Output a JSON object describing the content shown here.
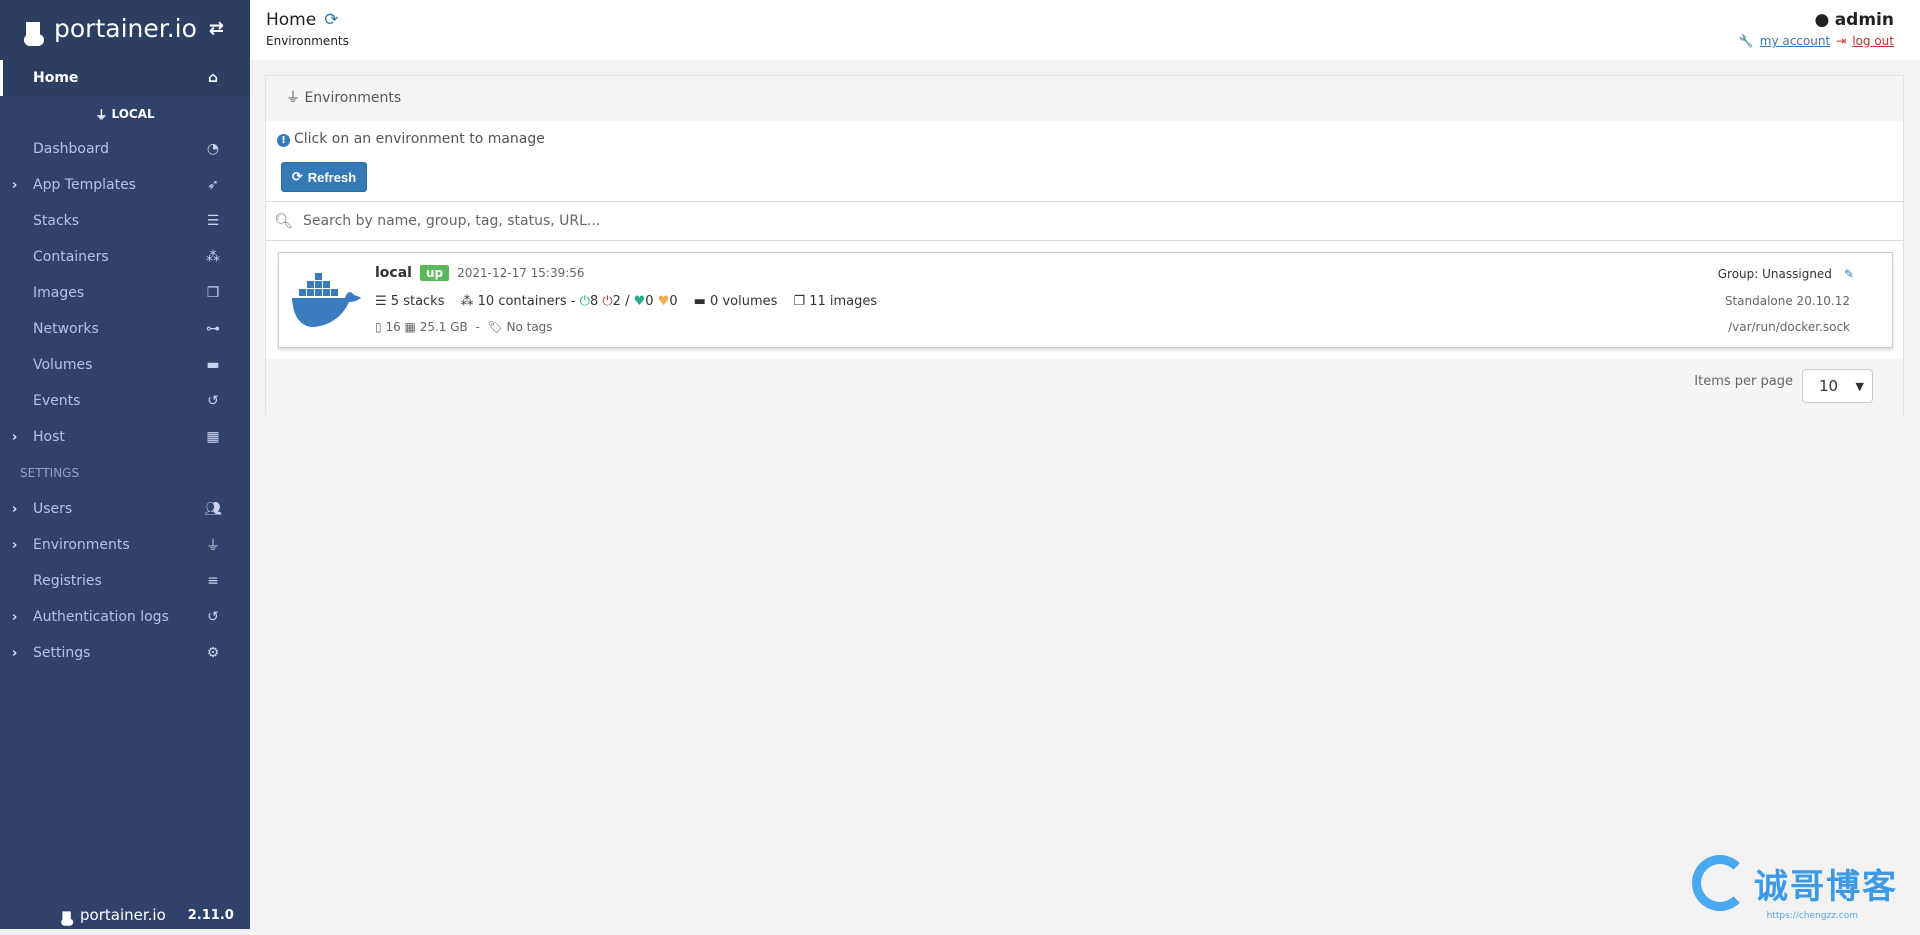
{
  "sidebar": {
    "logo_text": "portainer.io",
    "home": "Home",
    "env_label": "LOCAL",
    "items": [
      {
        "label": "Dashboard",
        "icon": "tachometer-icon"
      },
      {
        "label": "App Templates",
        "icon": "rocket-icon",
        "expandable": true
      },
      {
        "label": "Stacks",
        "icon": "th-list-icon"
      },
      {
        "label": "Containers",
        "icon": "cubes-icon"
      },
      {
        "label": "Images",
        "icon": "clone-icon"
      },
      {
        "label": "Networks",
        "icon": "sitemap-icon"
      },
      {
        "label": "Volumes",
        "icon": "hdd-icon"
      },
      {
        "label": "Events",
        "icon": "history-icon"
      },
      {
        "label": "Host",
        "icon": "th-icon",
        "expandable": true
      }
    ],
    "settings_header": "SETTINGS",
    "settings_items": [
      {
        "label": "Users",
        "icon": "users-icon",
        "expandable": true
      },
      {
        "label": "Environments",
        "icon": "plug-icon",
        "expandable": true
      },
      {
        "label": "Registries",
        "icon": "database-icon"
      },
      {
        "label": "Authentication logs",
        "icon": "history-icon",
        "expandable": true
      },
      {
        "label": "Settings",
        "icon": "cogs-icon",
        "expandable": true
      }
    ],
    "footer_logo": "portainer.io",
    "version": "2.11.0"
  },
  "header": {
    "title": "Home",
    "breadcrumb": "Environments",
    "user": "admin",
    "my_account": "my account",
    "log_out": "log out"
  },
  "panel": {
    "title": "Environments",
    "info": "Click on an environment to manage",
    "refresh": "Refresh",
    "search_placeholder": "Search by name, group, tag, status, URL...",
    "environment": {
      "name": "local",
      "status": "up",
      "date": "2021-12-17 15:39:56",
      "stacks": "5 stacks",
      "containers": "10 containers -",
      "running": "8",
      "stopped": "2 /",
      "healthy": "0",
      "unhealthy": "0",
      "volumes": "0 volumes",
      "images": "11 images",
      "cpu": "16",
      "memory": "25.1 GB",
      "sep": "-",
      "tags": "No tags",
      "group": "Group: Unassigned",
      "type": "Standalone 20.10.12",
      "url": "/var/run/docker.sock"
    },
    "items_per_page_label": "Items per page",
    "items_per_page": "10"
  },
  "watermark": {
    "text": "诚哥博客",
    "url": "https://chengzz.com"
  },
  "colors": {
    "sidebar": "#30426a",
    "primary": "#337ab7",
    "up": "#5cb85c"
  }
}
